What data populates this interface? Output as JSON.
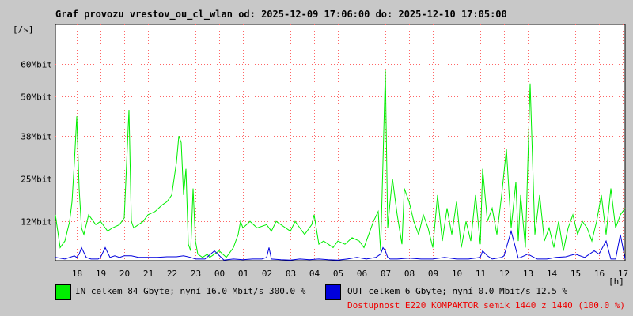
{
  "title": "Graf provozu vrestov_ou_cl_wlan od: 2025-12-09 17:06:00 do: 2025-12-10 17:05:00",
  "colors": {
    "background": "#c8c8c8",
    "plot_background": "#ffffff",
    "in": "#00ee00",
    "out": "#0000dd",
    "grid": "#ff6666",
    "availability": "#ee0000"
  },
  "legend": {
    "in_text": "IN celkem 84 Gbyte; nyní  16.0 Mbit/s 300.0 %",
    "out_text": "OUT celkem 6 Gbyte; nyní   0.0 Mbit/s 12.5 %",
    "availability_text": "Dostupnost E220 KOMPAKTOR semik 1440 z 1440 (100.0 %)"
  },
  "chart_data": {
    "type": "line",
    "ylabel": "[/s]",
    "xlabel": "[h]",
    "grid": true,
    "ylim": [
      0,
      72
    ],
    "xlim": [
      17.1,
      41.1
    ],
    "y_ticks": [
      {
        "value": 12,
        "label": "12Mbit"
      },
      {
        "value": 25,
        "label": "25Mbit"
      },
      {
        "value": 38,
        "label": "38Mbit"
      },
      {
        "value": 50,
        "label": "50Mbit"
      },
      {
        "value": 60,
        "label": "60Mbit"
      }
    ],
    "x_ticks": [
      {
        "value": 18,
        "label": "18"
      },
      {
        "value": 19,
        "label": "19"
      },
      {
        "value": 20,
        "label": "20"
      },
      {
        "value": 21,
        "label": "21"
      },
      {
        "value": 22,
        "label": "22"
      },
      {
        "value": 23,
        "label": "23"
      },
      {
        "value": 24,
        "label": "00"
      },
      {
        "value": 25,
        "label": "01"
      },
      {
        "value": 26,
        "label": "02"
      },
      {
        "value": 27,
        "label": "03"
      },
      {
        "value": 28,
        "label": "04"
      },
      {
        "value": 29,
        "label": "05"
      },
      {
        "value": 30,
        "label": "06"
      },
      {
        "value": 31,
        "label": "07"
      },
      {
        "value": 32,
        "label": "08"
      },
      {
        "value": 33,
        "label": "09"
      },
      {
        "value": 34,
        "label": "10"
      },
      {
        "value": 35,
        "label": "11"
      },
      {
        "value": 36,
        "label": "12"
      },
      {
        "value": 37,
        "label": "13"
      },
      {
        "value": 38,
        "label": "14"
      },
      {
        "value": 39,
        "label": "15"
      },
      {
        "value": 40,
        "label": "16"
      },
      {
        "value": 41,
        "label": "17"
      }
    ],
    "series": [
      {
        "name": "IN",
        "x": [
          17.1,
          17.3,
          17.5,
          17.7,
          17.8,
          17.9,
          18.0,
          18.1,
          18.2,
          18.3,
          18.5,
          18.8,
          19.0,
          19.3,
          19.5,
          19.8,
          20.0,
          20.2,
          20.3,
          20.4,
          20.6,
          20.8,
          21.0,
          21.3,
          21.6,
          21.8,
          22.0,
          22.2,
          22.3,
          22.4,
          22.5,
          22.6,
          22.7,
          22.8,
          22.9,
          23.0,
          23.1,
          23.3,
          23.5,
          23.6,
          23.8,
          24.0,
          24.3,
          24.6,
          24.8,
          24.9,
          25.0,
          25.3,
          25.6,
          26.0,
          26.2,
          26.4,
          26.6,
          26.8,
          27.0,
          27.2,
          27.4,
          27.6,
          27.9,
          28.0,
          28.2,
          28.4,
          28.6,
          28.8,
          29.0,
          29.3,
          29.6,
          29.9,
          30.1,
          30.3,
          30.5,
          30.7,
          30.8,
          30.9,
          31.0,
          31.1,
          31.2,
          31.3,
          31.5,
          31.7,
          31.8,
          32.0,
          32.2,
          32.4,
          32.6,
          32.8,
          33.0,
          33.2,
          33.4,
          33.6,
          33.8,
          34.0,
          34.2,
          34.4,
          34.6,
          34.8,
          35.0,
          35.1,
          35.3,
          35.5,
          35.7,
          35.9,
          36.1,
          36.3,
          36.5,
          36.6,
          36.7,
          36.9,
          37.1,
          37.3,
          37.5,
          37.7,
          37.9,
          38.1,
          38.3,
          38.5,
          38.7,
          38.9,
          39.1,
          39.3,
          39.5,
          39.7,
          39.9,
          40.1,
          40.3,
          40.5,
          40.7,
          40.9,
          41.1
        ],
        "values": [
          14,
          4,
          6,
          12,
          18,
          30,
          44,
          22,
          10,
          8,
          14,
          11,
          12,
          9,
          10,
          11,
          13,
          46,
          12,
          10,
          11,
          12,
          14,
          15,
          17,
          18,
          20,
          30,
          38,
          36,
          20,
          28,
          5,
          3,
          22,
          6,
          2,
          1,
          2,
          1,
          2,
          3,
          1,
          4,
          8,
          12,
          10,
          12,
          10,
          11,
          9,
          12,
          11,
          10,
          9,
          12,
          10,
          8,
          11,
          14,
          5,
          6,
          5,
          4,
          6,
          5,
          7,
          6,
          4,
          8,
          12,
          15,
          3,
          30,
          58,
          10,
          18,
          25,
          14,
          5,
          22,
          18,
          12,
          8,
          14,
          10,
          4,
          20,
          6,
          16,
          8,
          18,
          4,
          12,
          6,
          20,
          5,
          28,
          12,
          16,
          8,
          20,
          34,
          10,
          24,
          6,
          20,
          4,
          54,
          8,
          20,
          6,
          10,
          4,
          12,
          3,
          10,
          14,
          8,
          12,
          10,
          6,
          12,
          20,
          8,
          22,
          10,
          14,
          16
        ]
      },
      {
        "name": "OUT",
        "x": [
          17.1,
          17.5,
          17.9,
          18.0,
          18.1,
          18.2,
          18.4,
          18.6,
          18.9,
          19.0,
          19.2,
          19.4,
          19.6,
          19.8,
          20.0,
          20.3,
          20.6,
          21.0,
          21.4,
          21.8,
          22.2,
          22.5,
          22.8,
          23.0,
          23.4,
          23.8,
          24.2,
          24.6,
          25.0,
          25.4,
          25.8,
          26.0,
          26.1,
          26.2,
          26.6,
          27.0,
          27.4,
          27.8,
          28.2,
          28.6,
          29.0,
          29.4,
          29.8,
          30.2,
          30.6,
          30.8,
          30.9,
          31.0,
          31.1,
          31.2,
          31.5,
          32.0,
          32.5,
          33.0,
          33.5,
          34.0,
          34.5,
          35.0,
          35.1,
          35.3,
          35.5,
          35.9,
          36.0,
          36.3,
          36.6,
          36.7,
          37.0,
          37.4,
          37.8,
          38.2,
          38.6,
          39.0,
          39.4,
          39.6,
          39.8,
          40.0,
          40.3,
          40.5,
          40.7,
          40.9,
          41.1
        ],
        "values": [
          1,
          0.5,
          1.5,
          1,
          2,
          4,
          1,
          0.5,
          0.5,
          1,
          4,
          1,
          1.5,
          1,
          1.5,
          1.5,
          1,
          1,
          1,
          1.2,
          1.2,
          1.5,
          1,
          0.5,
          0.5,
          3,
          0.2,
          0.5,
          0.3,
          0.5,
          0.5,
          1,
          4,
          0.5,
          0.3,
          0.2,
          0.5,
          0.3,
          0.5,
          0.3,
          0.2,
          0.5,
          1,
          0.5,
          1,
          2,
          4,
          3,
          1,
          0.5,
          0.5,
          0.8,
          0.5,
          0.5,
          1,
          0.5,
          0.5,
          1,
          3,
          1.5,
          0.5,
          1,
          1.5,
          9,
          0.8,
          1,
          2,
          0.5,
          0.5,
          1,
          1.2,
          2,
          1,
          2,
          3,
          2,
          6,
          0.5,
          0.5,
          8,
          0.5
        ]
      }
    ]
  }
}
